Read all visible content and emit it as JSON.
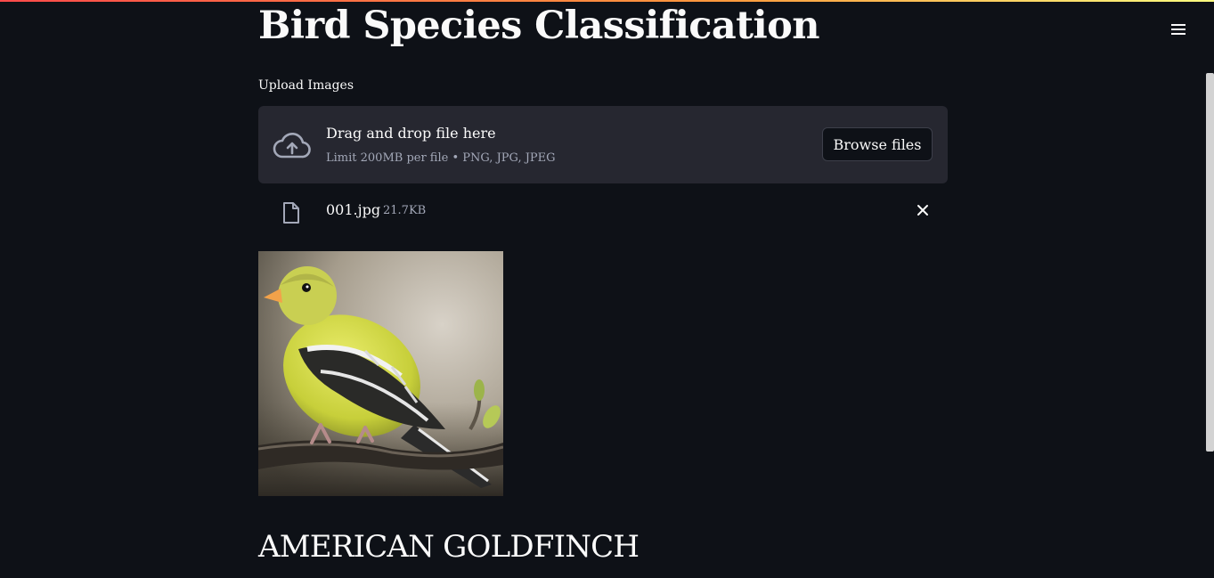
{
  "header": {
    "menu_icon": "hamburger-icon",
    "accent_gradient": [
      "#ff4b4b",
      "#ff9a3d",
      "#fffd80"
    ]
  },
  "main": {
    "title": "Bird Species Classification",
    "uploader": {
      "label": "Upload Images",
      "upload_icon": "cloud-upload-icon",
      "drop_text": "Drag and drop file here",
      "limit_text": "Limit 200MB per file • PNG, JPG, JPEG",
      "browse_label": "Browse files"
    },
    "uploaded_file": {
      "icon": "file-icon",
      "name": "001.jpg",
      "size": "21.7KB",
      "remove_icon": "close-icon"
    },
    "image_subject": "bird-photo",
    "prediction": "AMERICAN GOLDFINCH"
  },
  "colors": {
    "background": "#0e1117",
    "dropzone": "#262730",
    "text": "#fafafa",
    "muted_text": "#a3a8b8"
  }
}
